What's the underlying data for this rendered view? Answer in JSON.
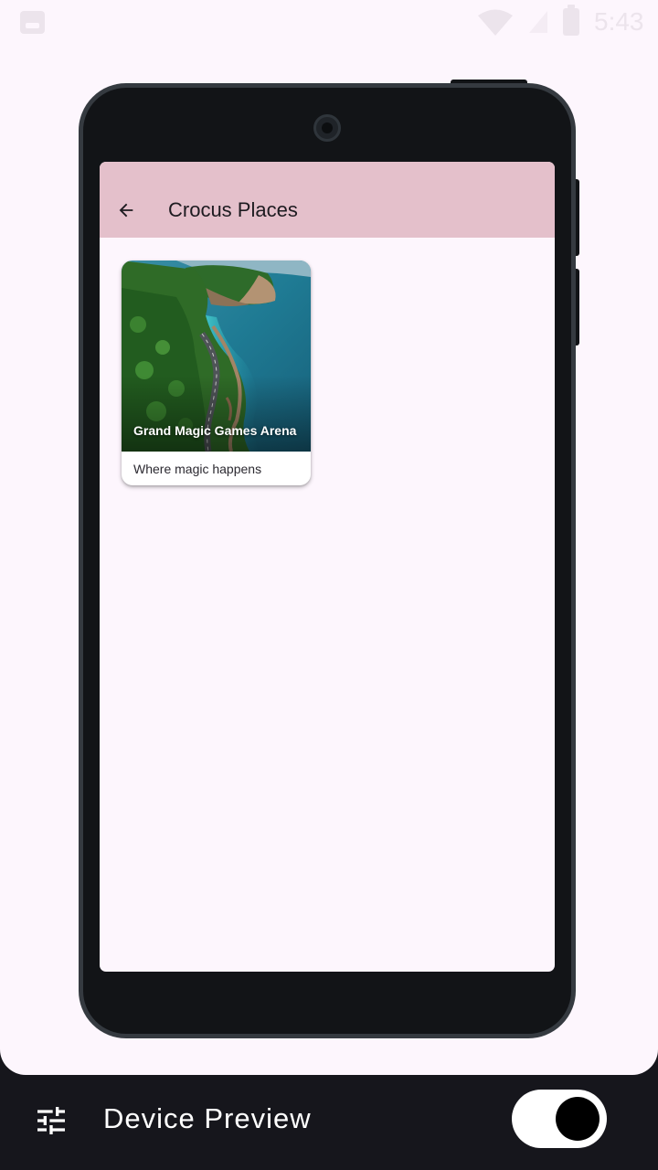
{
  "status_bar": {
    "time": "5:43",
    "icons": [
      "image-icon",
      "wifi-icon",
      "signal-icon",
      "battery-icon"
    ]
  },
  "app": {
    "title": "Crocus Places",
    "back_icon": "arrow-back-icon",
    "app_bar_color": "#e4c0cb",
    "background_color": "#fdf6fd"
  },
  "places": [
    {
      "title": "Grand Magic Games Arena",
      "subtitle": "Where magic happens",
      "image": "coastal-road-cliff-photo"
    }
  ],
  "device_preview": {
    "label": "Device Preview",
    "settings_icon": "tune-icon",
    "toggle_on": true
  }
}
